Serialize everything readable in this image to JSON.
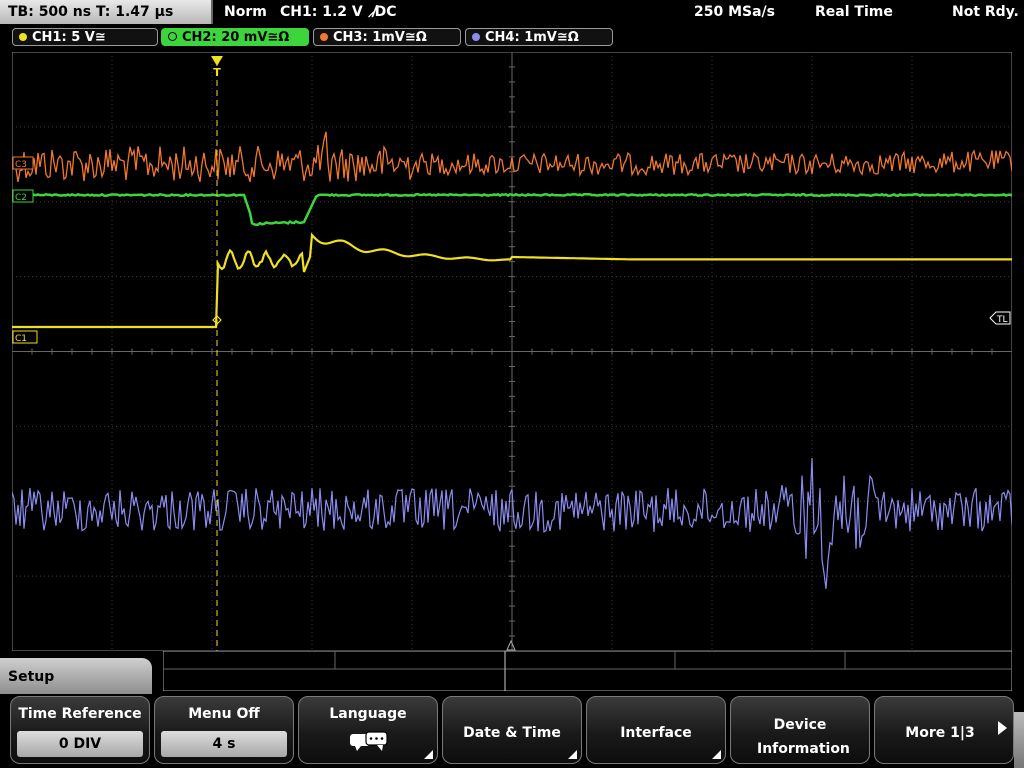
{
  "status": {
    "timebase": "TB: 500 ns   T: 1.47 µs",
    "mode": "Norm",
    "trigger": "CH1: 1.2 V ⸝̸DC",
    "sample_rate": "250 MSa/s",
    "acquisition": "Real Time",
    "ready": "Not Rdy."
  },
  "channels": [
    {
      "label": "CH1: 5 V≅",
      "color": "#f0e020"
    },
    {
      "label": "CH2: 20 mV≅Ω",
      "color": "#3cd63c"
    },
    {
      "label": "CH3: 1mV≅Ω",
      "color": "#f07830"
    },
    {
      "label": "CH4: 1mV≅Ω",
      "color": "#8c8cf0"
    }
  ],
  "markers": {
    "c1": "C1",
    "c2": "C2",
    "c3": "C3",
    "tl": "TL",
    "trigger": "T"
  },
  "menu": {
    "title": "Setup",
    "buttons": [
      {
        "label": "Time Reference",
        "value": "0 DIV"
      },
      {
        "label": "Menu Off",
        "value": "4 s"
      },
      {
        "label": "Language",
        "icon": "speech-bubble-icon"
      },
      {
        "label": "Date & Time"
      },
      {
        "label": "Interface"
      },
      {
        "label": "Device Information"
      },
      {
        "label": "More 1|3"
      }
    ]
  }
}
